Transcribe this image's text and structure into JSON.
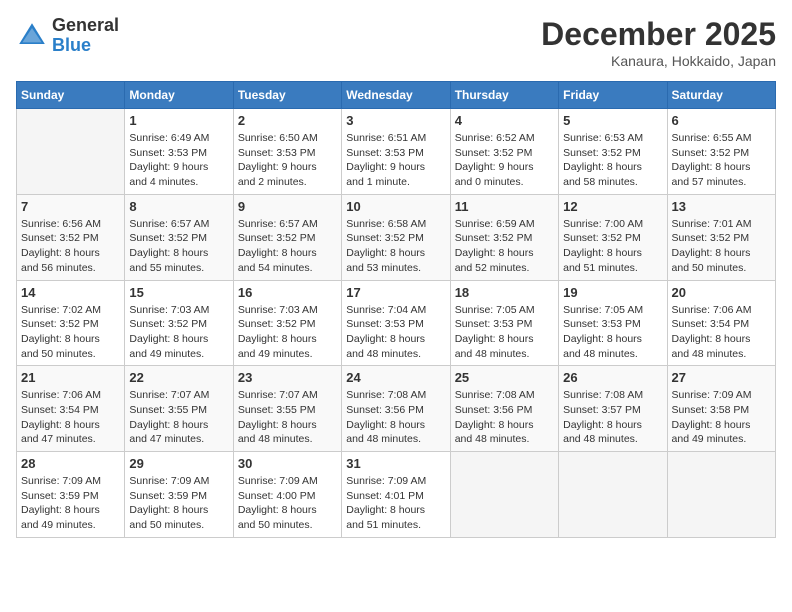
{
  "header": {
    "logo_general": "General",
    "logo_blue": "Blue",
    "month": "December 2025",
    "location": "Kanaura, Hokkaido, Japan"
  },
  "days_of_week": [
    "Sunday",
    "Monday",
    "Tuesday",
    "Wednesday",
    "Thursday",
    "Friday",
    "Saturday"
  ],
  "weeks": [
    [
      {
        "day": "",
        "info": ""
      },
      {
        "day": "1",
        "info": "Sunrise: 6:49 AM\nSunset: 3:53 PM\nDaylight: 9 hours\nand 4 minutes."
      },
      {
        "day": "2",
        "info": "Sunrise: 6:50 AM\nSunset: 3:53 PM\nDaylight: 9 hours\nand 2 minutes."
      },
      {
        "day": "3",
        "info": "Sunrise: 6:51 AM\nSunset: 3:53 PM\nDaylight: 9 hours\nand 1 minute."
      },
      {
        "day": "4",
        "info": "Sunrise: 6:52 AM\nSunset: 3:52 PM\nDaylight: 9 hours\nand 0 minutes."
      },
      {
        "day": "5",
        "info": "Sunrise: 6:53 AM\nSunset: 3:52 PM\nDaylight: 8 hours\nand 58 minutes."
      },
      {
        "day": "6",
        "info": "Sunrise: 6:55 AM\nSunset: 3:52 PM\nDaylight: 8 hours\nand 57 minutes."
      }
    ],
    [
      {
        "day": "7",
        "info": "Sunrise: 6:56 AM\nSunset: 3:52 PM\nDaylight: 8 hours\nand 56 minutes."
      },
      {
        "day": "8",
        "info": "Sunrise: 6:57 AM\nSunset: 3:52 PM\nDaylight: 8 hours\nand 55 minutes."
      },
      {
        "day": "9",
        "info": "Sunrise: 6:57 AM\nSunset: 3:52 PM\nDaylight: 8 hours\nand 54 minutes."
      },
      {
        "day": "10",
        "info": "Sunrise: 6:58 AM\nSunset: 3:52 PM\nDaylight: 8 hours\nand 53 minutes."
      },
      {
        "day": "11",
        "info": "Sunrise: 6:59 AM\nSunset: 3:52 PM\nDaylight: 8 hours\nand 52 minutes."
      },
      {
        "day": "12",
        "info": "Sunrise: 7:00 AM\nSunset: 3:52 PM\nDaylight: 8 hours\nand 51 minutes."
      },
      {
        "day": "13",
        "info": "Sunrise: 7:01 AM\nSunset: 3:52 PM\nDaylight: 8 hours\nand 50 minutes."
      }
    ],
    [
      {
        "day": "14",
        "info": "Sunrise: 7:02 AM\nSunset: 3:52 PM\nDaylight: 8 hours\nand 50 minutes."
      },
      {
        "day": "15",
        "info": "Sunrise: 7:03 AM\nSunset: 3:52 PM\nDaylight: 8 hours\nand 49 minutes."
      },
      {
        "day": "16",
        "info": "Sunrise: 7:03 AM\nSunset: 3:52 PM\nDaylight: 8 hours\nand 49 minutes."
      },
      {
        "day": "17",
        "info": "Sunrise: 7:04 AM\nSunset: 3:53 PM\nDaylight: 8 hours\nand 48 minutes."
      },
      {
        "day": "18",
        "info": "Sunrise: 7:05 AM\nSunset: 3:53 PM\nDaylight: 8 hours\nand 48 minutes."
      },
      {
        "day": "19",
        "info": "Sunrise: 7:05 AM\nSunset: 3:53 PM\nDaylight: 8 hours\nand 48 minutes."
      },
      {
        "day": "20",
        "info": "Sunrise: 7:06 AM\nSunset: 3:54 PM\nDaylight: 8 hours\nand 48 minutes."
      }
    ],
    [
      {
        "day": "21",
        "info": "Sunrise: 7:06 AM\nSunset: 3:54 PM\nDaylight: 8 hours\nand 47 minutes."
      },
      {
        "day": "22",
        "info": "Sunrise: 7:07 AM\nSunset: 3:55 PM\nDaylight: 8 hours\nand 47 minutes."
      },
      {
        "day": "23",
        "info": "Sunrise: 7:07 AM\nSunset: 3:55 PM\nDaylight: 8 hours\nand 48 minutes."
      },
      {
        "day": "24",
        "info": "Sunrise: 7:08 AM\nSunset: 3:56 PM\nDaylight: 8 hours\nand 48 minutes."
      },
      {
        "day": "25",
        "info": "Sunrise: 7:08 AM\nSunset: 3:56 PM\nDaylight: 8 hours\nand 48 minutes."
      },
      {
        "day": "26",
        "info": "Sunrise: 7:08 AM\nSunset: 3:57 PM\nDaylight: 8 hours\nand 48 minutes."
      },
      {
        "day": "27",
        "info": "Sunrise: 7:09 AM\nSunset: 3:58 PM\nDaylight: 8 hours\nand 49 minutes."
      }
    ],
    [
      {
        "day": "28",
        "info": "Sunrise: 7:09 AM\nSunset: 3:59 PM\nDaylight: 8 hours\nand 49 minutes."
      },
      {
        "day": "29",
        "info": "Sunrise: 7:09 AM\nSunset: 3:59 PM\nDaylight: 8 hours\nand 50 minutes."
      },
      {
        "day": "30",
        "info": "Sunrise: 7:09 AM\nSunset: 4:00 PM\nDaylight: 8 hours\nand 50 minutes."
      },
      {
        "day": "31",
        "info": "Sunrise: 7:09 AM\nSunset: 4:01 PM\nDaylight: 8 hours\nand 51 minutes."
      },
      {
        "day": "",
        "info": ""
      },
      {
        "day": "",
        "info": ""
      },
      {
        "day": "",
        "info": ""
      }
    ]
  ]
}
